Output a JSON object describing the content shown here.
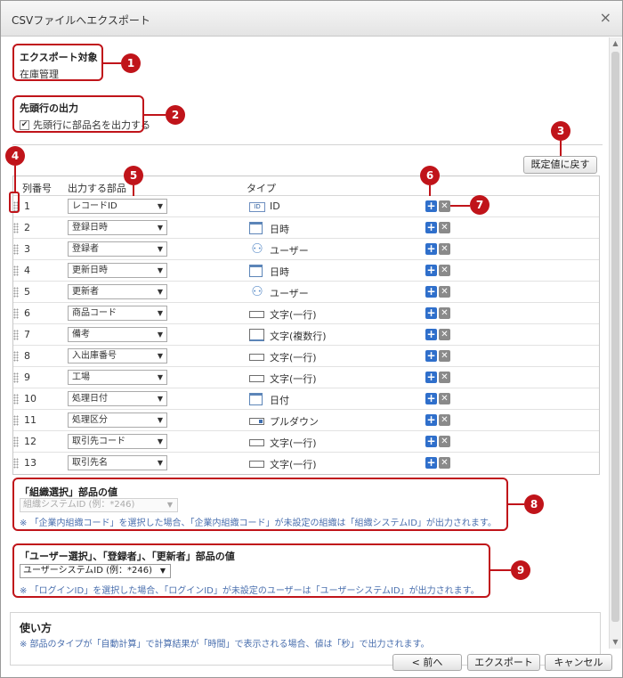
{
  "window": {
    "title": "CSVファイルへエクスポート",
    "close": "×"
  },
  "export_target": {
    "title": "エクスポート対象",
    "value": "在庫管理"
  },
  "header_row": {
    "title": "先頭行の出力",
    "checkbox_label": "先頭行に部品名を出力する",
    "checked": true
  },
  "reset_button": "既定値に戻す",
  "table": {
    "headers": {
      "col": "列番号",
      "field": "出力する部品",
      "type": "タイプ"
    },
    "rows": [
      {
        "num": "1",
        "field": "レコードID",
        "icon": "id-icon",
        "type": "ID"
      },
      {
        "num": "2",
        "field": "登録日時",
        "icon": "datetime-icon",
        "type": "日時"
      },
      {
        "num": "3",
        "field": "登録者",
        "icon": "user-icon",
        "type": "ユーザー"
      },
      {
        "num": "4",
        "field": "更新日時",
        "icon": "datetime-icon",
        "type": "日時"
      },
      {
        "num": "5",
        "field": "更新者",
        "icon": "user-icon",
        "type": "ユーザー"
      },
      {
        "num": "6",
        "field": "商品コード",
        "icon": "text-line-icon",
        "type": "文字(一行)"
      },
      {
        "num": "7",
        "field": "備考",
        "icon": "text-multi-icon",
        "type": "文字(複数行)"
      },
      {
        "num": "8",
        "field": "入出庫番号",
        "icon": "text-line-icon",
        "type": "文字(一行)"
      },
      {
        "num": "9",
        "field": "工場",
        "icon": "text-line-icon",
        "type": "文字(一行)"
      },
      {
        "num": "10",
        "field": "処理日付",
        "icon": "date-icon",
        "type": "日付"
      },
      {
        "num": "11",
        "field": "処理区分",
        "icon": "dropdown-icon",
        "type": "プルダウン"
      },
      {
        "num": "12",
        "field": "取引先コード",
        "icon": "text-line-icon",
        "type": "文字(一行)"
      },
      {
        "num": "13",
        "field": "取引先名",
        "icon": "text-line-icon",
        "type": "文字(一行)"
      }
    ]
  },
  "org_select": {
    "title": "「組織選択」部品の値",
    "select_value": "組織システムID (例：*246)",
    "note": "※ 「企業内組織コード」を選択した場合、「企業内組織コード」が未設定の組織は「組織システムID」が出力されます。"
  },
  "user_select": {
    "title": "「ユーザー選択」、「登録者」、「更新者」部品の値",
    "select_value": "ユーザーシステムID (例：*246)",
    "note": "※ 「ログインID」を選択した場合、「ログインID」が未設定のユーザーは「ユーザーシステムID」が出力されます。"
  },
  "usage": {
    "title": "使い方",
    "note": "※ 部品のタイプが「自動計算」で計算結果が「時間」で表示される場合、値は「秒」で出力されます。"
  },
  "footer": {
    "back": "< 前へ",
    "export": "エクスポート",
    "cancel": "キャンセル"
  },
  "callouts": [
    "1",
    "2",
    "3",
    "4",
    "5",
    "6",
    "7",
    "8",
    "9"
  ],
  "colors": {
    "callout": "#c0141a",
    "plus": "#2f6fcb",
    "note": "#4a6fae"
  }
}
